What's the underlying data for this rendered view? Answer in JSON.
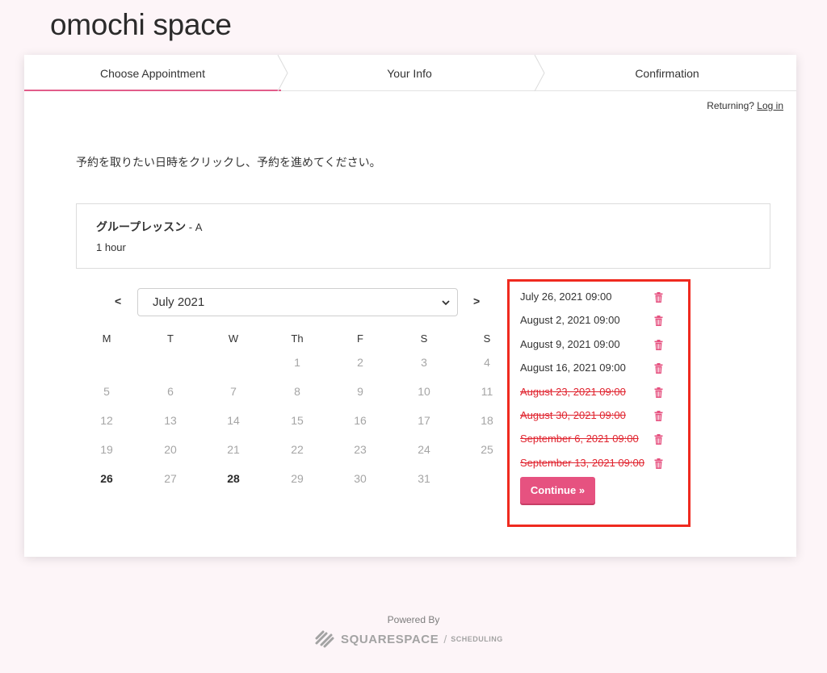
{
  "site": {
    "title": "omochi space"
  },
  "steps": [
    {
      "label": "Choose Appointment",
      "active": true
    },
    {
      "label": "Your Info",
      "active": false
    },
    {
      "label": "Confirmation",
      "active": false
    }
  ],
  "returning": {
    "prefix": "Returning?",
    "link_label": "Log in"
  },
  "instruction": "予約を取りたい日時をクリックし、予約を進めてください。",
  "appointment": {
    "name": "グループレッスン",
    "suffix": " - A",
    "duration": "1 hour"
  },
  "calendar": {
    "prev_label": "<",
    "next_label": ">",
    "month_label": "July 2021",
    "weekdays": [
      "M",
      "T",
      "W",
      "Th",
      "F",
      "S",
      "S"
    ],
    "weeks": [
      [
        null,
        null,
        null,
        "1",
        "2",
        "3",
        "4"
      ],
      [
        "5",
        "6",
        "7",
        "8",
        "9",
        "10",
        "11"
      ],
      [
        "12",
        "13",
        "14",
        "15",
        "16",
        "17",
        "18"
      ],
      [
        "19",
        "20",
        "21",
        "22",
        "23",
        "24",
        "25"
      ],
      [
        "26",
        "27",
        "28",
        "29",
        "30",
        "31",
        null
      ]
    ],
    "available_days": [
      "26",
      "28"
    ]
  },
  "selections": [
    {
      "label": "July 26, 2021 09:00",
      "struck": false
    },
    {
      "label": "August 2, 2021 09:00",
      "struck": false
    },
    {
      "label": "August 9, 2021 09:00",
      "struck": false
    },
    {
      "label": "August 16, 2021 09:00",
      "struck": false
    },
    {
      "label": "August 23, 2021 09:00",
      "struck": true
    },
    {
      "label": "August 30, 2021 09:00",
      "struck": true
    },
    {
      "label": "September 6, 2021 09:00",
      "struck": true
    },
    {
      "label": "September 13, 2021 09:00",
      "struck": true
    }
  ],
  "continue_label": "Continue »",
  "footer": {
    "powered_by": "Powered By",
    "brand": "SQUARESPACE",
    "product": "SCHEDULING"
  },
  "colors": {
    "accent": "#e65280",
    "highlight_border": "#ef2a1f",
    "struck_text": "#e0242f"
  },
  "icons": {
    "delete": "trash-icon",
    "logo": "squarespace-logo-icon"
  }
}
